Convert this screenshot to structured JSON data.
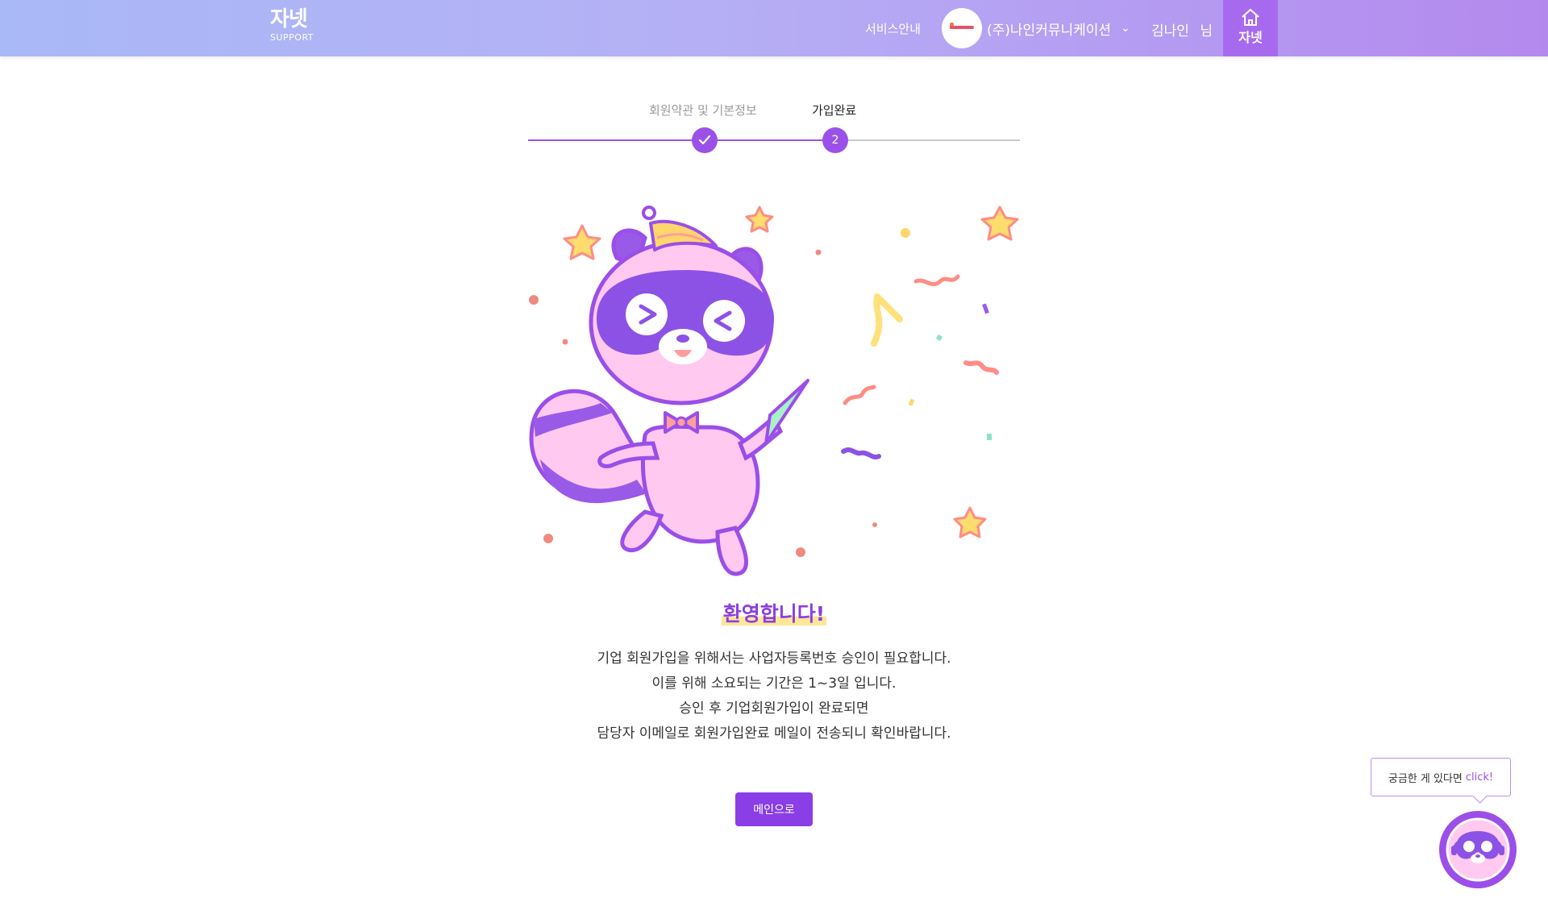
{
  "header": {
    "logo_main": "자넷",
    "logo_sub": "SUPPORT",
    "service_link": "서비스안내",
    "company_name": "(주)나인커뮤니케이션",
    "user_name": "김나인",
    "user_suffix": "님",
    "home_label": "자넷"
  },
  "stepper": {
    "steps": [
      {
        "label": "회원약관 및 기본정보",
        "state": "done",
        "marker": "check-icon"
      },
      {
        "label": "가입완료",
        "state": "current",
        "marker": "2"
      }
    ],
    "progress_color": "#9b51e8"
  },
  "main": {
    "welcome_title": "환영합니다!",
    "description_lines": [
      "기업 회원가입을 위해서는 사업자등록번호 승인이 필요합니다.",
      "이를 위해 소요되는 기간은 1~3일 입니다.",
      "승인 후 기업회원가입이 완료되면",
      "담당자 이메일로 회원가입완료 메일이 전송되니 확인바랍니다."
    ],
    "main_button": "메인으로"
  },
  "chat_widget": {
    "tooltip_text": "궁금한 게 있다면",
    "tooltip_highlight": "click!",
    "icon": "raccoon-chatbot-icon"
  },
  "colors": {
    "accent": "#9b51e8",
    "button": "#8a3ee5",
    "header_gradient_start": "#a9b8f7",
    "header_gradient_end": "#b489ee"
  }
}
